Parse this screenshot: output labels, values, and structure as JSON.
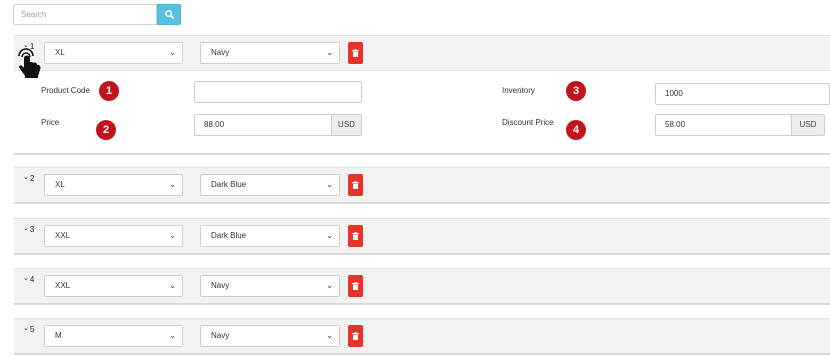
{
  "search": {
    "placeholder": "Search",
    "icon": "search-icon"
  },
  "variants": [
    {
      "index": "1",
      "size": "XL",
      "color": "Navy",
      "expanded": true
    },
    {
      "index": "2",
      "size": "XL",
      "color": "Dark Blue",
      "expanded": false
    },
    {
      "index": "3",
      "size": "XXL",
      "color": "Dark Blue",
      "expanded": false
    },
    {
      "index": "4",
      "size": "XXL",
      "color": "Navy",
      "expanded": false
    },
    {
      "index": "5",
      "size": "M",
      "color": "Navy",
      "expanded": false
    }
  ],
  "details": {
    "product_code_label": "Product Code",
    "product_code_value": "",
    "price_label": "Price",
    "price_value": "88.00",
    "inventory_label": "Inventory",
    "inventory_value": "1000",
    "discount_label": "Discount Price",
    "discount_value": "58.00",
    "currency": "USD"
  },
  "badges": [
    "1",
    "2",
    "3",
    "4"
  ],
  "colors": {
    "accent": "#5bc0de",
    "danger": "#e8332a",
    "badge": "#c3131c",
    "panel": "#f2f2f2"
  }
}
